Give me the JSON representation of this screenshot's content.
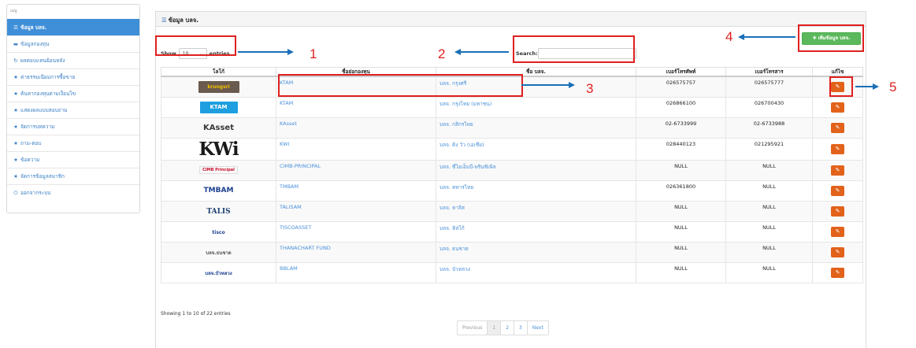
{
  "sidebar": {
    "header": "เมนู",
    "items": [
      {
        "icon": "list",
        "label": "ข้อมูล บลจ.",
        "active": true
      },
      {
        "icon": "folder",
        "label": "ข้อมูลกองทุน"
      },
      {
        "icon": "refresh",
        "label": "ผลตอบแทนย้อนหลัง"
      },
      {
        "icon": "star",
        "label": "ค่าธรรมเนียมการซื้อขาย"
      },
      {
        "icon": "star",
        "label": "ค้นหากองทุนตามเงื่อนไข"
      },
      {
        "icon": "star",
        "label": "แสดงผลแบบสอบถาม"
      },
      {
        "icon": "star",
        "label": "จัดการบทความ"
      },
      {
        "icon": "star",
        "label": "ถาม-ตอบ"
      },
      {
        "icon": "star",
        "label": "ข้อความ"
      },
      {
        "icon": "star",
        "label": "จัดการข้อมูลสมาชิก"
      },
      {
        "icon": "power",
        "label": "ออกจากระบบ"
      }
    ]
  },
  "panel": {
    "title": "ข้อมูล บลจ.",
    "add_button": "เพิ่มข้อมูล บลจ.",
    "length": {
      "show": "Show",
      "value": "10",
      "entries": "entries"
    },
    "search_label": "Search:",
    "columns": [
      "โลโก้",
      "ชื่อย่อกองทุน",
      "ชื่อ บลจ.",
      "เบอร์โทรศัพท์",
      "เบอร์โทรสาร",
      "แก้ไข"
    ],
    "rows": [
      {
        "logo": "krungsri",
        "short": "KTAM",
        "name": "บลจ. กรุงศรี",
        "phone": "026575757",
        "fax": "026575777"
      },
      {
        "logo": "ktam",
        "short": "KTAM",
        "name": "บลจ. กรุงไทย (มหาชน)",
        "phone": "026866100",
        "fax": "026700430"
      },
      {
        "logo": "kasset",
        "short": "KAsset",
        "name": "บลจ. กสิกรไทย",
        "phone": "02-6733999",
        "fax": "02-6733988"
      },
      {
        "logo": "kwi",
        "short": "KWI",
        "name": "บลจ. คิง วัว (เอเชีย)",
        "phone": "028440123",
        "fax": "021295921"
      },
      {
        "logo": "cimb",
        "short": "CIMB-PRINCIPAL",
        "name": "บลจ. ซีไอเอ็มบี-พรินซิเพิล",
        "phone": "NULL",
        "fax": "NULL"
      },
      {
        "logo": "tmbam",
        "short": "TMBAM",
        "name": "บลจ. ทหารไทย",
        "phone": "026361800",
        "fax": "NULL"
      },
      {
        "logo": "talis",
        "short": "TALISAM",
        "name": "บลจ. ทาลิส",
        "phone": "NULL",
        "fax": "NULL"
      },
      {
        "logo": "tisco",
        "short": "TISCOASSET",
        "name": "บลจ. ทิสโก้",
        "phone": "NULL",
        "fax": "NULL"
      },
      {
        "logo": "thanachart",
        "short": "THANACHART FUND",
        "name": "บลจ. ธนชาต",
        "phone": "NULL",
        "fax": "NULL"
      },
      {
        "logo": "bblam",
        "short": "BBLAM",
        "name": "บลจ. บัวหลวง",
        "phone": "NULL",
        "fax": "NULL"
      }
    ],
    "logo_text": {
      "krungsri": "krungsri",
      "ktam": "KTAM",
      "kasset": "KAsset",
      "kwi": "KWi",
      "cimb": "CIMB Principal",
      "tmbam": "TMBAM",
      "talis": "TALIS",
      "tisco": "tisco",
      "thanachart": "บลจ.ธนชาต",
      "bblam": "บลจ.บัวหลวง"
    },
    "edit_glyph": "✎",
    "info": "Showing 1 to 10 of 22 entries",
    "pagination": [
      "Previous",
      "1",
      "2",
      "3",
      "Next"
    ]
  },
  "annotations": [
    "1",
    "2",
    "3",
    "4",
    "5"
  ],
  "colors": {
    "accent": "#3f8fd8",
    "add": "#5cb85c",
    "edit": "#e2621b",
    "annotation": "#e02020",
    "arrow": "#1a6fb8"
  }
}
